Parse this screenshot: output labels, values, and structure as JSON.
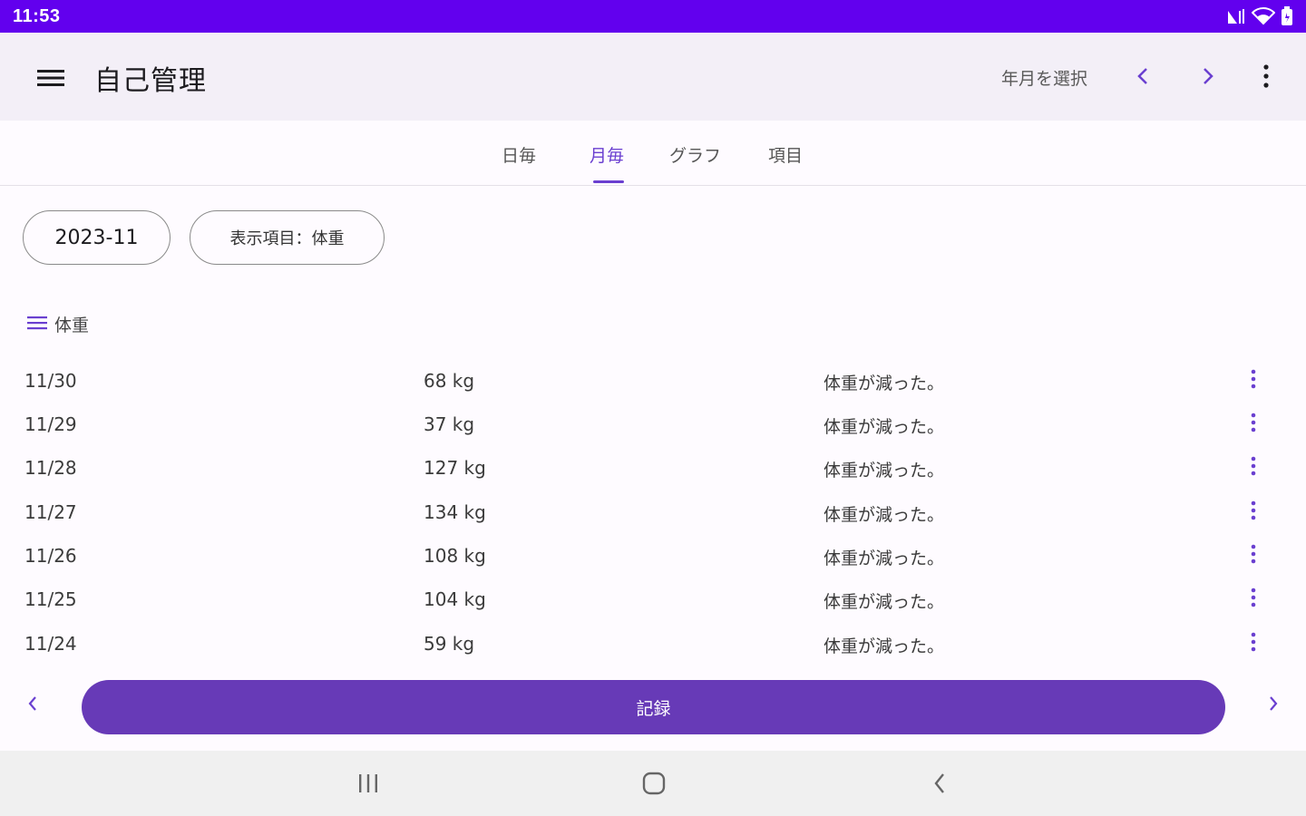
{
  "status_bar": {
    "time": "11:53",
    "icons": [
      "network-signal-icon",
      "wifi-icon",
      "battery-icon"
    ]
  },
  "app_bar": {
    "title": "自己管理",
    "select_year_month": "年月を選択",
    "icons": {
      "menu": "hamburger-menu-icon",
      "prev": "chevron-left-icon",
      "next": "chevron-right-icon",
      "more": "more-vertical-icon"
    }
  },
  "tabs": [
    {
      "label": "日毎",
      "active": false
    },
    {
      "label": "月毎",
      "active": true
    },
    {
      "label": "グラフ",
      "active": false
    },
    {
      "label": "項目",
      "active": false
    }
  ],
  "filters": {
    "date_chip": "2023-11",
    "display_item_chip": "表示項目：体重"
  },
  "section": {
    "label": "体重",
    "icon": "list-icon"
  },
  "rows": [
    {
      "date": "11/30",
      "value": "68 kg",
      "note": "体重が減った。"
    },
    {
      "date": "11/29",
      "value": "37 kg",
      "note": "体重が減った。"
    },
    {
      "date": "11/28",
      "value": "127 kg",
      "note": "体重が減った。"
    },
    {
      "date": "11/27",
      "value": "134 kg",
      "note": "体重が減った。"
    },
    {
      "date": "11/26",
      "value": "108 kg",
      "note": "体重が減った。"
    },
    {
      "date": "11/25",
      "value": "104 kg",
      "note": "体重が減った。"
    },
    {
      "date": "11/24",
      "value": "59 kg",
      "note": "体重が減った。"
    }
  ],
  "actions": {
    "record_label": "記録"
  },
  "colors": {
    "status_bar": "#6200ee",
    "accent": "#6a3fd0",
    "record_button": "#673ab7",
    "app_bar_bg": "#f3eff7"
  }
}
